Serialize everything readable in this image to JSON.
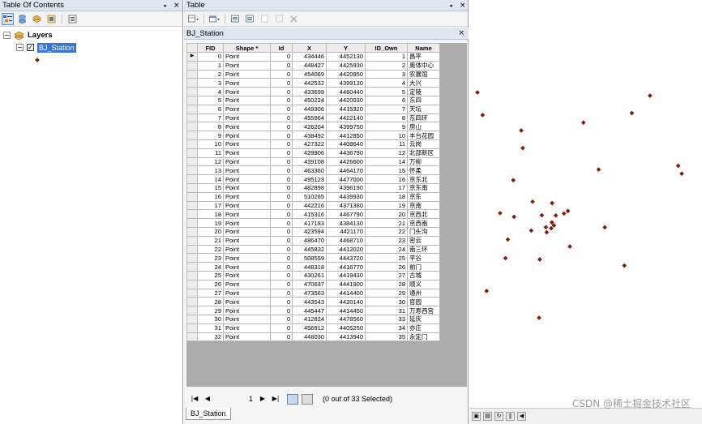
{
  "toc": {
    "title": "Table Of Contents",
    "pin": "ᵖ",
    "close": "×",
    "root_label": "Layers",
    "layer_label": "BJ_Station",
    "layer_checked": true
  },
  "table_window": {
    "title": "Table",
    "pin": "ᵖ",
    "close": "×",
    "tab_title": "BJ_Station",
    "tab_close": "×",
    "columns": [
      "FID",
      "Shape *",
      "Id",
      "X",
      "Y",
      "ID_Own",
      "Name"
    ],
    "rows": [
      [
        "0",
        "Point",
        "0",
        "434446",
        "4452130",
        "1",
        "昌平"
      ],
      [
        "1",
        "Point",
        "0",
        "448427",
        "4425930",
        "2",
        "奥体中心"
      ],
      [
        "2",
        "Point",
        "0",
        "454069",
        "4420950",
        "3",
        "农展馆"
      ],
      [
        "3",
        "Point",
        "0",
        "442532",
        "4399130",
        "4",
        "大兴"
      ],
      [
        "4",
        "Point",
        "0",
        "433699",
        "4460440",
        "5",
        "定陵"
      ],
      [
        "5",
        "Point",
        "0",
        "450224",
        "4420030",
        "6",
        "东四"
      ],
      [
        "6",
        "Point",
        "0",
        "449306",
        "4415320",
        "7",
        "天坛"
      ],
      [
        "7",
        "Point",
        "0",
        "455964",
        "4422140",
        "8",
        "东四环"
      ],
      [
        "8",
        "Point",
        "0",
        "426204",
        "4399750",
        "9",
        "房山"
      ],
      [
        "9",
        "Point",
        "0",
        "438492",
        "4412850",
        "10",
        "丰台花园"
      ],
      [
        "10",
        "Point",
        "0",
        "427322",
        "4408640",
        "11",
        "云岗"
      ],
      [
        "11",
        "Point",
        "0",
        "429906",
        "4436790",
        "12",
        "北部新区"
      ],
      [
        "12",
        "Point",
        "0",
        "439108",
        "4426600",
        "14",
        "万柳"
      ],
      [
        "13",
        "Point",
        "0",
        "463360",
        "4464170",
        "15",
        "怀柔"
      ],
      [
        "14",
        "Point",
        "0",
        "495123",
        "4477000",
        "16",
        "京东北"
      ],
      [
        "15",
        "Point",
        "0",
        "482898",
        "4396190",
        "17",
        "京东南"
      ],
      [
        "16",
        "Point",
        "0",
        "510265",
        "4439930",
        "18",
        "京东"
      ],
      [
        "17",
        "Point",
        "0",
        "442216",
        "4371380",
        "19",
        "京南"
      ],
      [
        "18",
        "Point",
        "0",
        "415316",
        "4467790",
        "20",
        "京西北"
      ],
      [
        "19",
        "Point",
        "0",
        "417183",
        "4384130",
        "21",
        "京西南"
      ],
      [
        "20",
        "Point",
        "0",
        "423594",
        "4421170",
        "22",
        "门头沟"
      ],
      [
        "21",
        "Point",
        "0",
        "486470",
        "4468710",
        "23",
        "密云"
      ],
      [
        "22",
        "Point",
        "0",
        "445832",
        "4412020",
        "24",
        "南三环"
      ],
      [
        "23",
        "Point",
        "0",
        "508559",
        "4443720",
        "25",
        "平谷"
      ],
      [
        "24",
        "Point",
        "0",
        "448318",
        "4416770",
        "26",
        "前门"
      ],
      [
        "25",
        "Point",
        "0",
        "430261",
        "4419430",
        "27",
        "古城"
      ],
      [
        "26",
        "Point",
        "0",
        "470637",
        "4441900",
        "28",
        "顺义"
      ],
      [
        "27",
        "Point",
        "0",
        "473563",
        "4414400",
        "29",
        "通州"
      ],
      [
        "28",
        "Point",
        "0",
        "443543",
        "4420140",
        "30",
        "官园"
      ],
      [
        "29",
        "Point",
        "0",
        "445447",
        "4414450",
        "31",
        "万寿西宫"
      ],
      [
        "30",
        "Point",
        "0",
        "412824",
        "4478560",
        "33",
        "延庆"
      ],
      [
        "31",
        "Point",
        "0",
        "456912",
        "4405250",
        "34",
        "亦庄"
      ],
      [
        "32",
        "Point",
        "0",
        "448030",
        "4413940",
        "35",
        "永定门"
      ]
    ],
    "nav": {
      "first": "|◀",
      "prev": "◀",
      "record": "1",
      "next": "▶",
      "last": "▶|",
      "selection_status": "(0 out of 33 Selected)"
    },
    "bottom_tab": "BJ_Station"
  },
  "map": {
    "point_color": "#7a1f10",
    "watermark": "CSDN @稀土掘金技术社区"
  }
}
